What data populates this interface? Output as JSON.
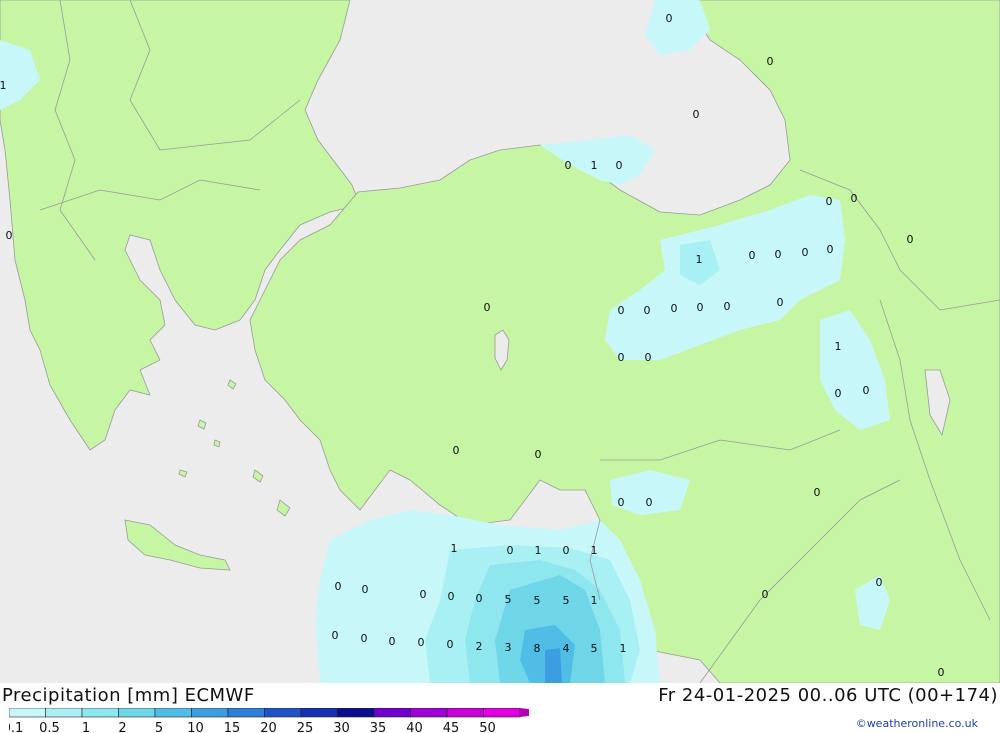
{
  "map": {
    "colors": {
      "land": "#c6f5a4",
      "sea": "#ececec",
      "border": "#999999"
    },
    "values": [
      "0",
      "0",
      "1",
      "0",
      "0",
      "1",
      "0",
      "0",
      "0",
      "0",
      "0",
      "0",
      "1",
      "0",
      "0",
      "0",
      "0",
      "0",
      "0",
      "0",
      "0",
      "0",
      "0",
      "0",
      "0",
      "0",
      "1",
      "0",
      "0",
      "0",
      "0",
      "0",
      "0",
      "0",
      "0",
      "1",
      "0",
      "1",
      "0",
      "1",
      "0",
      "0",
      "0",
      "5",
      "5",
      "5",
      "1",
      "0",
      "0",
      "0",
      "0",
      "0",
      "0",
      "2",
      "3",
      "8",
      "4",
      "5",
      "1",
      "0",
      "0",
      "0"
    ]
  },
  "footer": {
    "title": "Precipitation [mm] ECMWF",
    "timestamp": "Fr 24-01-2025 00..06 UTC (00+174)",
    "credit": "©weatheronline.co.uk"
  },
  "legend": {
    "ticks": [
      "0.1",
      "0.5",
      "1",
      "2",
      "5",
      "10",
      "15",
      "20",
      "25",
      "30",
      "35",
      "40",
      "45",
      "50"
    ],
    "colors": [
      "#c8f7fa",
      "#a9f0f5",
      "#8ee6ee",
      "#6fd6e8",
      "#50bde6",
      "#3c9ee0",
      "#2f7ed8",
      "#2153c8",
      "#1530b0",
      "#0a0f90",
      "#7000d0",
      "#a000d8",
      "#c800d8",
      "#e000e0",
      "#b000b0"
    ]
  }
}
